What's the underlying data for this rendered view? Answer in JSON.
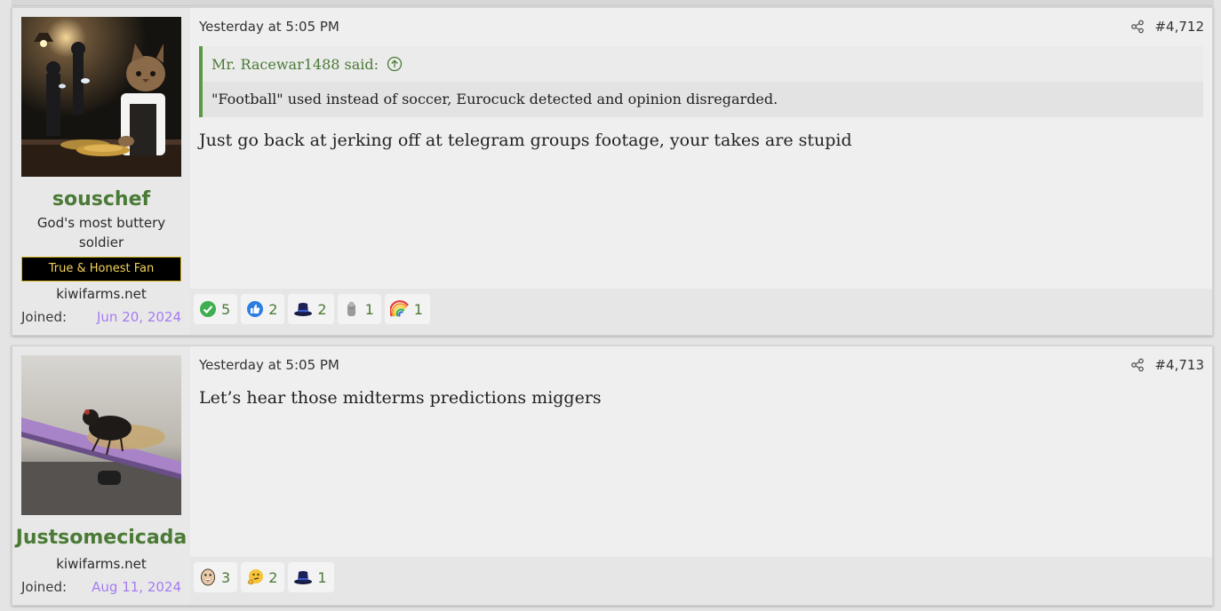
{
  "posts": [
    {
      "username": "souschef",
      "user_title": "God's most buttery soldier",
      "banner": "True & Honest Fan",
      "site": "kiwifarms.net",
      "joined_label": "Joined:",
      "joined_date": "Jun 20, 2024",
      "date": "Yesterday at 5:05 PM",
      "post_number": "#4,712",
      "quote": {
        "author": "Mr. Racewar1488 said:",
        "text": "\"Football\" used instead of soccer, Eurocuck detected and opinion disregarded."
      },
      "message": "Just go back at jerking off at telegram groups footage, your takes are stupid",
      "reactions": [
        {
          "icon": "check-icon",
          "count": "5"
        },
        {
          "icon": "thumbs-up-icon",
          "count": "2"
        },
        {
          "icon": "top-hat-icon",
          "count": "2"
        },
        {
          "icon": "gray-figure-icon",
          "count": "1"
        },
        {
          "icon": "rainbow-icon",
          "count": "1"
        }
      ]
    },
    {
      "username": "Justsomecicada",
      "site": "kiwifarms.net",
      "joined_label": "Joined:",
      "joined_date": "Aug 11, 2024",
      "date": "Yesterday at 5:05 PM",
      "post_number": "#4,713",
      "message": "Let’s hear those midterms predictions miggers",
      "reactions": [
        {
          "icon": "laughing-face-icon",
          "count": "3"
        },
        {
          "icon": "thinking-face-icon",
          "count": "2"
        },
        {
          "icon": "top-hat-icon",
          "count": "1"
        }
      ]
    }
  ],
  "colors": {
    "username": "#4a7a35",
    "joined_date": "#a57cf0",
    "banner_text": "#f4d25a",
    "quote_border": "#5a9a45"
  }
}
